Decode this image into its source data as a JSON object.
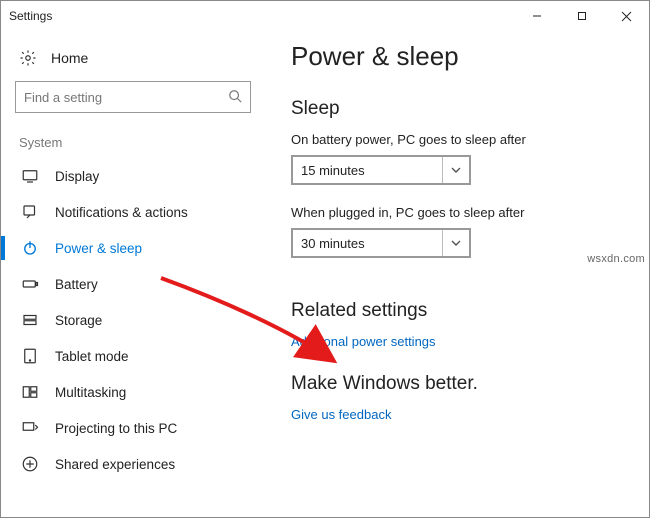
{
  "window": {
    "title": "Settings"
  },
  "home": {
    "label": "Home"
  },
  "search": {
    "placeholder": "Find a setting"
  },
  "section_label": "System",
  "nav": {
    "items": [
      {
        "label": "Display"
      },
      {
        "label": "Notifications & actions"
      },
      {
        "label": "Power & sleep"
      },
      {
        "label": "Battery"
      },
      {
        "label": "Storage"
      },
      {
        "label": "Tablet mode"
      },
      {
        "label": "Multitasking"
      },
      {
        "label": "Projecting to this PC"
      },
      {
        "label": "Shared experiences"
      }
    ]
  },
  "main": {
    "title": "Power & sleep",
    "sleep": {
      "heading": "Sleep",
      "battery_label": "On battery power, PC goes to sleep after",
      "battery_value": "15 minutes",
      "plugged_label": "When plugged in, PC goes to sleep after",
      "plugged_value": "30 minutes"
    },
    "related": {
      "heading": "Related settings",
      "link": "Additional power settings"
    },
    "feedback": {
      "heading": "Make Windows better.",
      "link": "Give us feedback"
    }
  },
  "watermark": "wsxdn.com"
}
